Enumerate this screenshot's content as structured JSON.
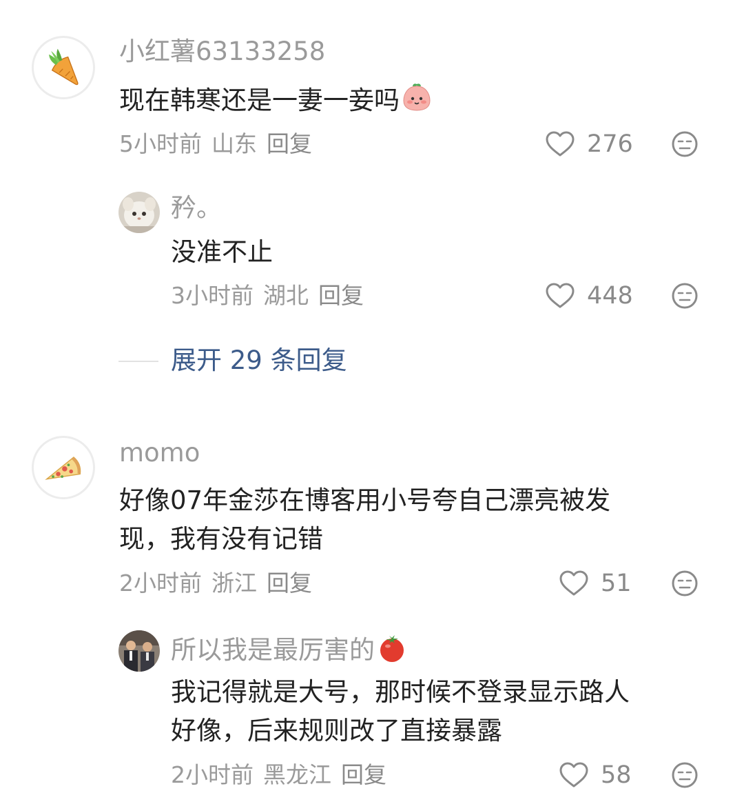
{
  "comments": [
    {
      "username": "小红薯63133258",
      "text": "现在韩寒还是一妻一妾吗",
      "text_emoji": "pink-blob-emoji",
      "time": "5小时前",
      "location": "山东",
      "reply": "回复",
      "likes": "276",
      "avatar_icon": "carrot-icon",
      "replies": [
        {
          "username": "矜。",
          "text": "没准不止",
          "time": "3小时前",
          "location": "湖北",
          "reply": "回复",
          "likes": "448",
          "avatar_icon": "cat-photo-avatar"
        }
      ],
      "expand_label": "展开 29 条回复"
    },
    {
      "username": "momo",
      "text_line1": "好像07年金莎在博客用小号夸自己漂亮被发",
      "text_line2": "现，我有没有记错",
      "time": "2小时前",
      "location": "浙江",
      "reply": "回复",
      "likes": "51",
      "avatar_icon": "pizza-icon",
      "replies": [
        {
          "username": "所以我是最厉害的",
          "username_emoji": "tomato-emoji",
          "text_line1": "我记得就是大号，那时候不登录显示路人",
          "text_line2": "好像，后来规则改了直接暴露",
          "time": "2小时前",
          "location": "黑龙江",
          "reply": "回复",
          "likes": "58",
          "avatar_icon": "people-photo-avatar"
        }
      ]
    }
  ],
  "colors": {
    "username": "#9a9a9a",
    "text": "#222222",
    "meta": "#9a9a9a",
    "link": "#3c5b8a",
    "icon": "#8a8a8a"
  }
}
